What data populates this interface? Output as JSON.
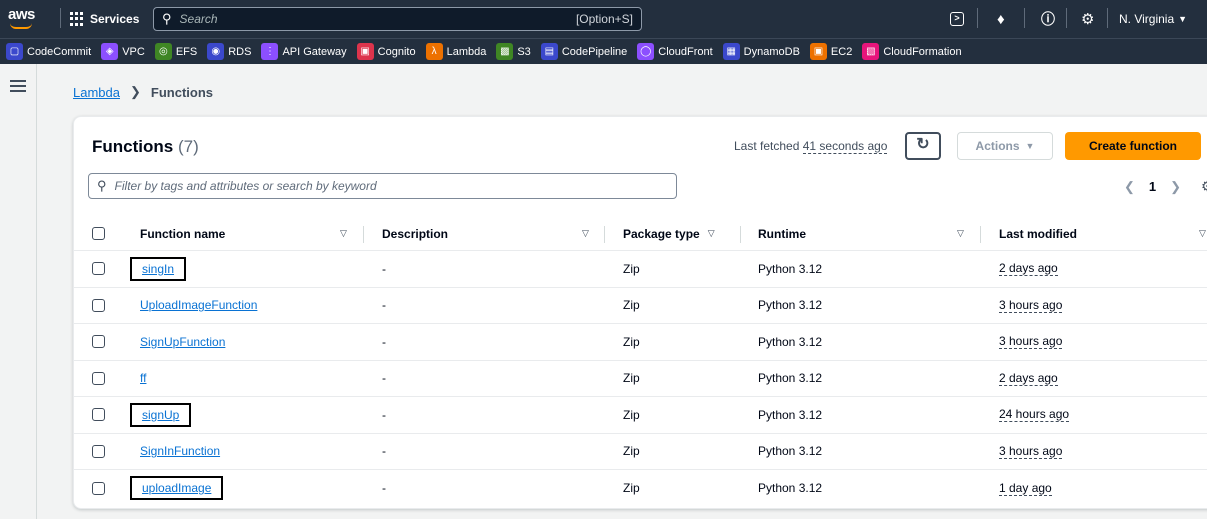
{
  "topnav": {
    "logo": "aws",
    "services_label": "Services",
    "search_placeholder": "Search",
    "search_shortcut": "[Option+S]",
    "region": "N. Virginia"
  },
  "favorites": [
    {
      "label": "CodeCommit",
      "color": "#3b48cc",
      "icon": "codecommit-icon"
    },
    {
      "label": "VPC",
      "color": "#8c4fff",
      "icon": "vpc-icon"
    },
    {
      "label": "EFS",
      "color": "#3f8624",
      "icon": "efs-icon"
    },
    {
      "label": "RDS",
      "color": "#3b48cc",
      "icon": "rds-icon"
    },
    {
      "label": "API Gateway",
      "color": "#8c4fff",
      "icon": "api-gateway-icon"
    },
    {
      "label": "Cognito",
      "color": "#dd344c",
      "icon": "cognito-icon"
    },
    {
      "label": "Lambda",
      "color": "#ed7100",
      "icon": "lambda-icon"
    },
    {
      "label": "S3",
      "color": "#3f8624",
      "icon": "s3-icon"
    },
    {
      "label": "CodePipeline",
      "color": "#3b48cc",
      "icon": "codepipeline-icon"
    },
    {
      "label": "CloudFront",
      "color": "#8c4fff",
      "icon": "cloudfront-icon"
    },
    {
      "label": "DynamoDB",
      "color": "#3b48cc",
      "icon": "dynamodb-icon"
    },
    {
      "label": "EC2",
      "color": "#ed7100",
      "icon": "ec2-icon"
    },
    {
      "label": "CloudFormation",
      "color": "#e7157b",
      "icon": "cloudformation-icon"
    }
  ],
  "breadcrumb": {
    "parent": "Lambda",
    "current": "Functions"
  },
  "panel": {
    "title": "Functions",
    "count": "(7)",
    "fetched_prefix": "Last fetched",
    "fetched_time": "41 seconds ago",
    "actions_label": "Actions",
    "create_label": "Create function",
    "filter_placeholder": "Filter by tags and attributes or search by keyword",
    "page_number": "1"
  },
  "table": {
    "headers": {
      "name": "Function name",
      "description": "Description",
      "package": "Package type",
      "runtime": "Runtime",
      "modified": "Last modified"
    },
    "rows": [
      {
        "name": "singIn",
        "description": "-",
        "package": "Zip",
        "runtime": "Python 3.12",
        "modified": "2 days ago"
      },
      {
        "name": "UploadImageFunction",
        "description": "-",
        "package": "Zip",
        "runtime": "Python 3.12",
        "modified": "3 hours ago"
      },
      {
        "name": "SignUpFunction",
        "description": "-",
        "package": "Zip",
        "runtime": "Python 3.12",
        "modified": "3 hours ago"
      },
      {
        "name": "ff",
        "description": "-",
        "package": "Zip",
        "runtime": "Python 3.12",
        "modified": "2 days ago"
      },
      {
        "name": "signUp",
        "description": "-",
        "package": "Zip",
        "runtime": "Python 3.12",
        "modified": "24 hours ago"
      },
      {
        "name": "SignInFunction",
        "description": "-",
        "package": "Zip",
        "runtime": "Python 3.12",
        "modified": "3 hours ago"
      },
      {
        "name": "uploadImage",
        "description": "-",
        "package": "Zip",
        "runtime": "Python 3.12",
        "modified": "1 day ago"
      }
    ]
  }
}
